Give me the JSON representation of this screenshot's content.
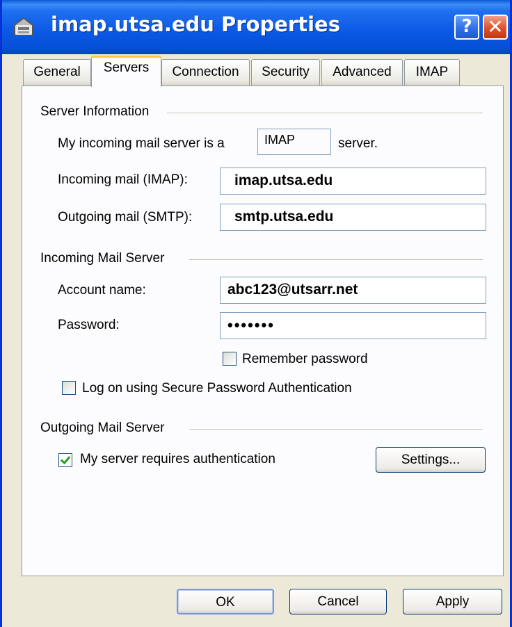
{
  "window": {
    "title": "imap.utsa.edu Properties"
  },
  "title_buttons": {
    "help": "?",
    "close": "✕"
  },
  "tabs": [
    {
      "label": "General"
    },
    {
      "label": "Servers"
    },
    {
      "label": "Connection"
    },
    {
      "label": "Security"
    },
    {
      "label": "Advanced"
    },
    {
      "label": "IMAP"
    }
  ],
  "server_info": {
    "group_label": "Server Information",
    "incoming_type_prefix": "My incoming mail server is a",
    "incoming_type": "IMAP",
    "incoming_type_suffix": "server.",
    "incoming_label": "Incoming mail (IMAP):",
    "incoming_value": "imap.utsa.edu",
    "outgoing_label": "Outgoing mail (SMTP):",
    "outgoing_value": "smtp.utsa.edu"
  },
  "incoming_server": {
    "group_label": "Incoming Mail Server",
    "account_label": "Account name:",
    "account_value": "abc123@utsarr.net",
    "password_label": "Password:",
    "password_value": "•••••••",
    "remember_label": "Remember password",
    "remember_checked": false,
    "spa_label": "Log on using Secure Password Authentication",
    "spa_checked": false
  },
  "outgoing_server": {
    "group_label": "Outgoing Mail Server",
    "auth_label": "My server requires authentication",
    "auth_checked": true,
    "settings_label": "Settings..."
  },
  "footer": {
    "ok_label": "OK",
    "cancel_label": "Cancel",
    "apply_label": "Apply"
  },
  "colors": {
    "titlebar": "#0a58e4",
    "dialog": "#ece9d8",
    "tab_highlight": "#ffc83c",
    "check": "#21a121"
  }
}
